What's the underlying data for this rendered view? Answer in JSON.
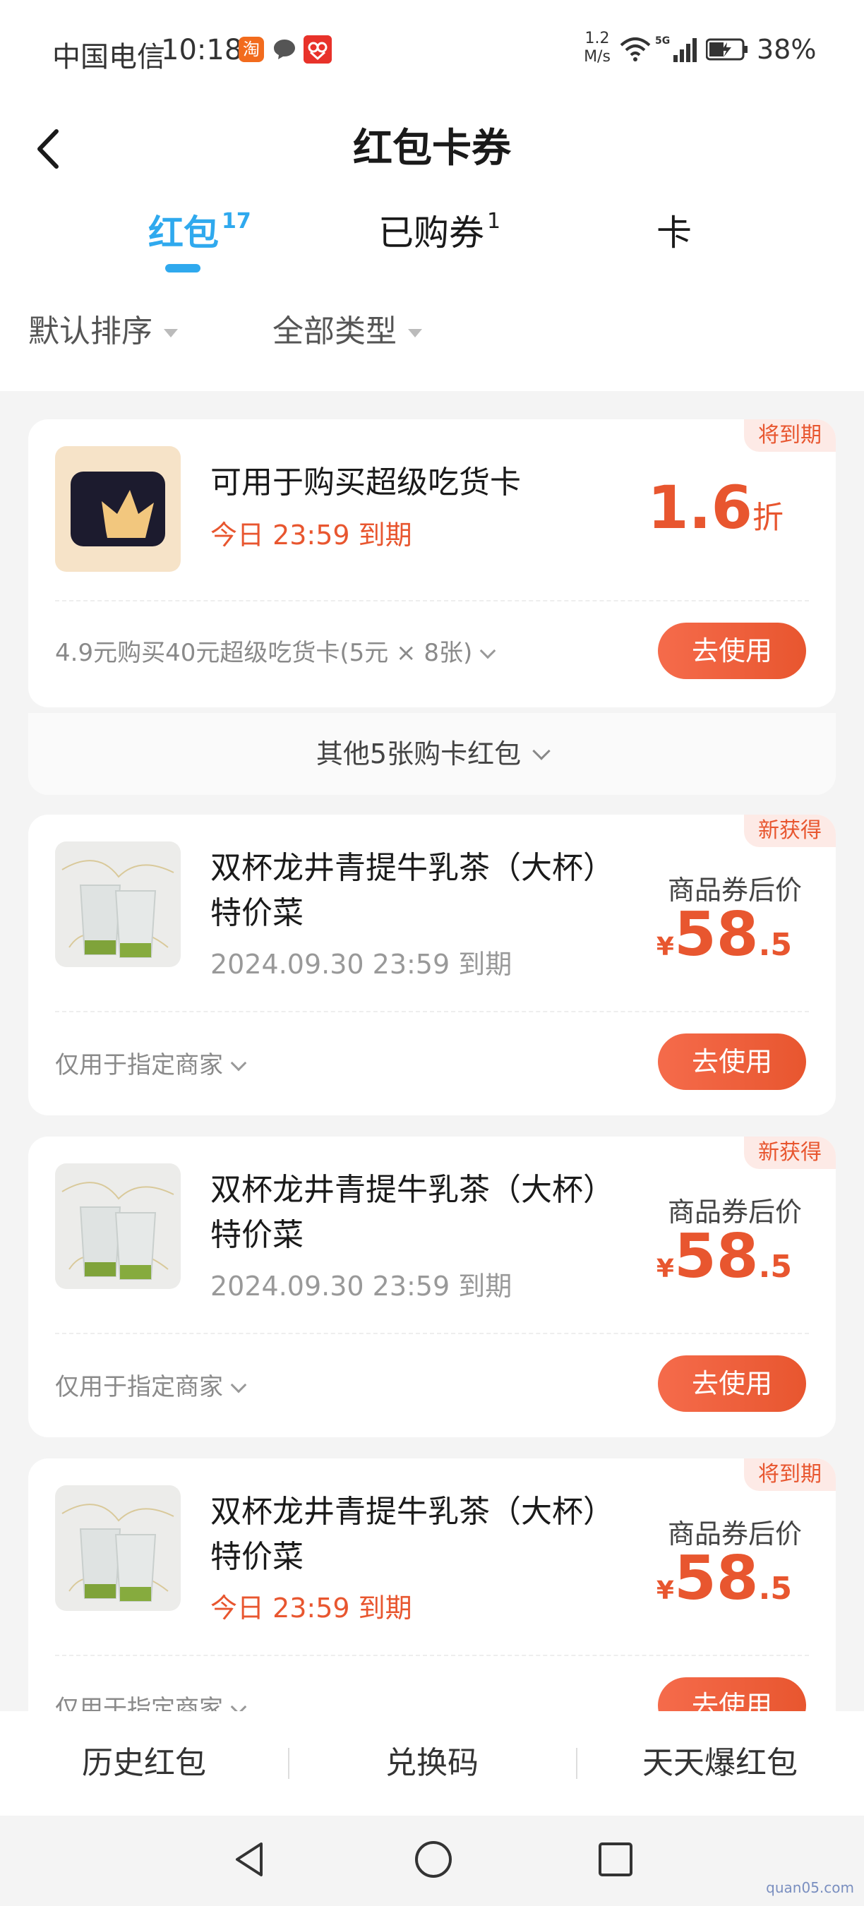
{
  "status_bar": {
    "carrier": "中国电信",
    "time": "10:18",
    "taobao_badge": "淘",
    "speed_value": "1.2",
    "speed_unit": "M/s",
    "network": "5G",
    "battery": "38%"
  },
  "header": {
    "title": "红包卡券",
    "back_icon": "chevron-left-icon"
  },
  "tabs": [
    {
      "label": "红包",
      "count": "17",
      "active": true
    },
    {
      "label": "已购券",
      "count": "1",
      "active": false
    },
    {
      "label": "卡",
      "count": "",
      "active": false
    }
  ],
  "filters": {
    "sort": "默认排序",
    "type": "全部类型"
  },
  "cards": [
    {
      "tag": "将到期",
      "title": "可用于购买超级吃货卡",
      "expire": "今日 23:59 到期",
      "discount_value": "1.6",
      "discount_unit": "折",
      "footnote": "4.9元购买40元超级吃货卡(5元 × 8张)",
      "button": "去使用",
      "thumb_icon": "crown-card-icon"
    },
    {
      "tag": "新获得",
      "title_line1": "双杯龙井青提牛乳茶（大杯）",
      "title_line2": "特价菜",
      "expire": "2024.09.30 23:59 到期",
      "price_label": "商品券后价",
      "currency": "¥",
      "price_int": "58",
      "price_dec": ".5",
      "footnote": "仅用于指定商家",
      "button": "去使用"
    },
    {
      "tag": "新获得",
      "title_line1": "双杯龙井青提牛乳茶（大杯）",
      "title_line2": "特价菜",
      "expire": "2024.09.30 23:59 到期",
      "price_label": "商品券后价",
      "currency": "¥",
      "price_int": "58",
      "price_dec": ".5",
      "footnote": "仅用于指定商家",
      "button": "去使用"
    },
    {
      "tag": "将到期",
      "title_line1": "双杯龙井青提牛乳茶（大杯）",
      "title_line2": "特价菜",
      "expire": "今日 23:59 到期",
      "price_label": "商品券后价",
      "currency": "¥",
      "price_int": "58",
      "price_dec": ".5",
      "footnote": "仅用于指定商家",
      "button": "去使用"
    }
  ],
  "more_row": "其他5张购卡红包",
  "bottom_bar": [
    "历史红包",
    "兑换码",
    "天天爆红包"
  ],
  "watermark": "quan05.com",
  "colors": {
    "accent_blue": "#2fa9ee",
    "accent_red": "#e8562f",
    "tag_bg": "#fdeae6"
  }
}
